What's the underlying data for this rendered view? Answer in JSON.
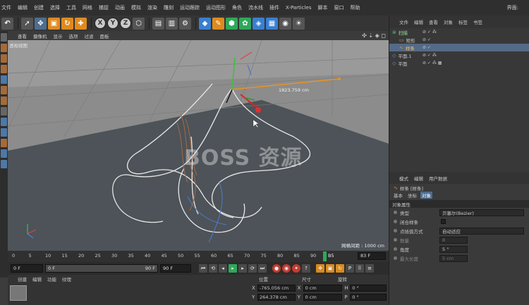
{
  "menubar": {
    "items": [
      "文件",
      "编辑",
      "创建",
      "选择",
      "工具",
      "网格",
      "捕捉",
      "动画",
      "模拟",
      "渲染",
      "雕刻",
      "运动跟踪",
      "运动图形",
      "角色",
      "流水线",
      "插件",
      "X-Particles",
      "脚本",
      "窗口",
      "帮助"
    ],
    "layout_label": "界面: "
  },
  "viewport": {
    "menu": [
      "查看",
      "摄像机",
      "显示",
      "选项",
      "过滤",
      "面板"
    ],
    "label": "透视视图",
    "controls": "✣ ⇣ ◈ ◻",
    "grid_spacing": "网格间距 : 1000 cm",
    "distance_readout": "1823.759 cm",
    "watermark": "BOSS 资源"
  },
  "timeline": {
    "ticks": [
      "0",
      "5",
      "10",
      "15",
      "20",
      "25",
      "30",
      "35",
      "40",
      "45",
      "50",
      "55",
      "60",
      "65",
      "70",
      "75",
      "80",
      "85",
      "90"
    ],
    "current_frame": "B5",
    "end_frame": "83 F"
  },
  "playback": {
    "start": "0 F",
    "range_start": "0 F",
    "range_end": "90 F",
    "max": "90 F"
  },
  "material_panel": {
    "menu": [
      "创建",
      "编辑",
      "功能",
      "纹理"
    ]
  },
  "coordinates": {
    "headers": [
      "位置",
      "尺寸",
      "旋转"
    ],
    "rows": [
      {
        "axis": "X",
        "position": "-765.056 cm",
        "size_axis": "X",
        "size": "0 cm",
        "rot_axis": "H",
        "rotation": "0 °"
      },
      {
        "axis": "Y",
        "position": "264.378 cm",
        "size_axis": "Y",
        "size": "0 cm",
        "rot_axis": "P",
        "rotation": "0 °"
      }
    ]
  },
  "objects_panel": {
    "menu": [
      "文件",
      "编辑",
      "查看",
      "对象",
      "标签",
      "书签"
    ],
    "objects": [
      {
        "name": "扫描",
        "indent": 0,
        "tags": "⊘ ✓ ⁂"
      },
      {
        "name": "矩形",
        "indent": 1,
        "tags": "⊘ ✓"
      },
      {
        "name": "样条",
        "indent": 1,
        "tags": "⊘ ✓",
        "selected": true
      },
      {
        "name": "平面.1",
        "indent": 0,
        "tags": "⊘ ✓ ⁂"
      },
      {
        "name": "平面",
        "indent": 0,
        "tags": "⊘ ✓ ⁂ ▦"
      }
    ]
  },
  "attributes_panel": {
    "menu": [
      "模式",
      "编辑",
      "用户数据"
    ],
    "title": "样条 [样条]",
    "tabs": [
      "基本",
      "坐标",
      "对象"
    ],
    "section": "对象属性",
    "fields": [
      {
        "label": "类型",
        "value": "贝塞尔(Bezier)"
      },
      {
        "label": "闭合样条",
        "value": ""
      },
      {
        "label": "点插值方式",
        "value": "自动适应"
      },
      {
        "label": "数量",
        "value": "8"
      },
      {
        "label": "角度",
        "value": "5 °"
      },
      {
        "label": "最大长度",
        "value": "5 cm"
      }
    ]
  },
  "colors": {
    "accent": "#4f6d8f",
    "orange": "#e08a1e",
    "spline": "#e8e8e8",
    "blue_spline": "#4d78c8"
  }
}
